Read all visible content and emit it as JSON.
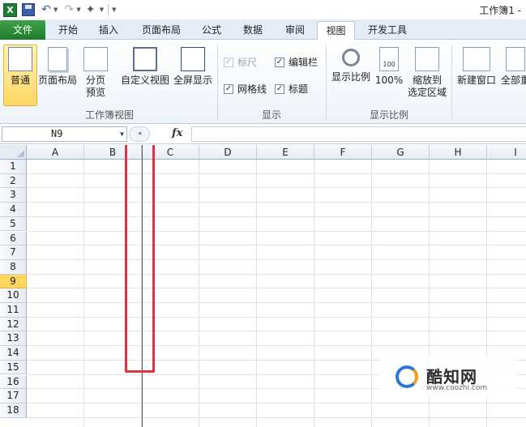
{
  "app": {
    "title": "工作簿1 -"
  },
  "tabs": [
    {
      "label": "文件"
    },
    {
      "label": "开始"
    },
    {
      "label": "插入"
    },
    {
      "label": "页面布局"
    },
    {
      "label": "公式"
    },
    {
      "label": "数据"
    },
    {
      "label": "审阅"
    },
    {
      "label": "视图"
    },
    {
      "label": "开发工具"
    }
  ],
  "active_tab": "视图",
  "ribbon": {
    "workbook_views": {
      "label": "工作簿视图",
      "normal": "普通",
      "page_layout": "页面布局",
      "page_break_1": "分页",
      "page_break_2": "预览",
      "custom_views": "自定义视图",
      "full_screen": "全屏显示"
    },
    "show": {
      "label": "显示",
      "ruler": "标尺",
      "formula_bar": "编辑栏",
      "gridlines": "网格线",
      "headings": "标题"
    },
    "zoom": {
      "label": "显示比例",
      "zoom": "显示比例",
      "hundred": "100%",
      "hundred_icon_text": "100",
      "zoom_sel_1": "缩放到",
      "zoom_sel_2": "选定区域"
    },
    "window": {
      "new_window": "新建窗口",
      "arrange_all": "全部重"
    }
  },
  "formula_bar": {
    "name_box": "N9",
    "fx": "fx",
    "value": ""
  },
  "grid": {
    "columns": [
      "A",
      "B",
      "C",
      "D",
      "E",
      "F",
      "G",
      "H",
      "I"
    ],
    "rows": [
      "1",
      "2",
      "3",
      "4",
      "5",
      "6",
      "7",
      "8",
      "9",
      "10",
      "11",
      "12",
      "13",
      "14",
      "15",
      "16",
      "17",
      "18"
    ],
    "active_row": "9",
    "active_cell": "N9"
  },
  "watermark": {
    "name": "酷知网",
    "url": "www.coozhi.com"
  },
  "colors": {
    "highlight": "#e1333f",
    "file_tab": "#1f7a2c",
    "active_row_header": "#ffd75e"
  }
}
